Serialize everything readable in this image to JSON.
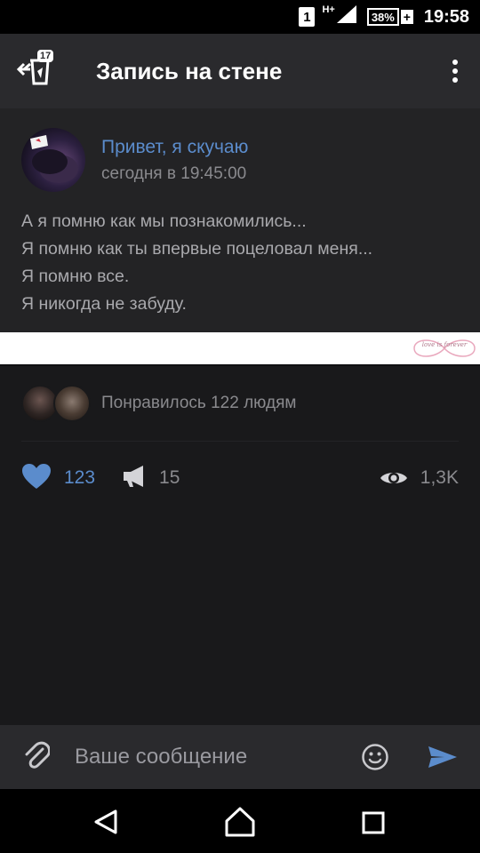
{
  "status_bar": {
    "sim_slot": "1",
    "network": "H+",
    "battery": "38%",
    "time": "19:58"
  },
  "app_bar": {
    "title": "Запись на стене",
    "badge_count": "17",
    "back_icon": "back-arrow-icon",
    "menu_icon": "more-vertical-icon"
  },
  "post": {
    "author": "Привет, я скучаю",
    "timestamp": "сегодня в 19:45:00",
    "lines": [
      "А я помню как мы познакомились...",
      "Я помню как ты впервые поцеловал меня...",
      "Я помню все.",
      "Я никогда не забуду."
    ]
  },
  "banner": {
    "watermark": "love is forever"
  },
  "likes": {
    "text": "Понравилось 122 людям"
  },
  "actions": {
    "likes_count": "123",
    "shares_count": "15",
    "views_count": "1,3K"
  },
  "composer": {
    "placeholder": "Ваше сообщение"
  },
  "colors": {
    "accent": "#5b8ccc",
    "background": "#19191b",
    "app_bar": "#2a2a2d",
    "post_bg": "#232325"
  }
}
